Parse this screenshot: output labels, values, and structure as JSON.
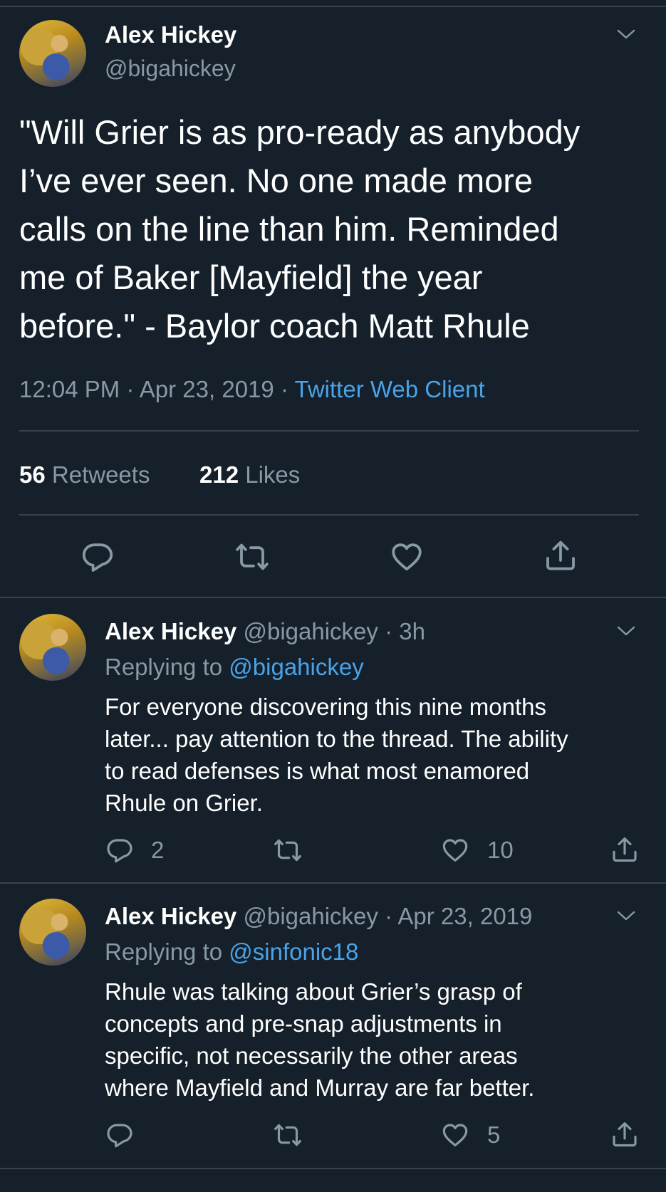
{
  "main_tweet": {
    "author_name": "Alex Hickey",
    "author_handle": "@bigahickey",
    "text_lines": [
      "\"Will Grier is as pro-ready as anybody",
      "I’ve ever seen. No one made more",
      "calls on the line than him. Reminded",
      "me of Baker [Mayfield] the year",
      "before.\" - Baylor coach Matt Rhule"
    ],
    "time": "12:04 PM",
    "date": "Apr 23, 2019",
    "separator": "·",
    "client": "Twitter Web Client",
    "retweets_count": "56",
    "retweets_label": "Retweets",
    "likes_count": "212",
    "likes_label": "Likes"
  },
  "replies": [
    {
      "author_name": "Alex Hickey",
      "author_handle": "@bigahickey",
      "time_ago": "· 3h",
      "replying_prefix": "Replying to",
      "replying_to": "@bigahickey",
      "text_lines": [
        "For everyone discovering this nine months",
        "later... pay attention to the thread. The ability",
        "to read defenses is what most enamored",
        "Rhule on Grier."
      ],
      "reply_count": "2",
      "retweet_count": "",
      "like_count": "10"
    },
    {
      "author_name": "Alex Hickey",
      "author_handle": "@bigahickey",
      "time_ago": "· Apr 23, 2019",
      "replying_prefix": "Replying to",
      "replying_to": "@sinfonic18",
      "text_lines": [
        "Rhule was talking about Grier’s grasp of",
        "concepts and pre-snap adjustments in",
        "specific, not necessarily the other areas",
        "where Mayfield and Murray are far better."
      ],
      "reply_count": "",
      "retweet_count": "",
      "like_count": "5"
    }
  ],
  "icons": {
    "reply": "reply-icon",
    "retweet": "retweet-icon",
    "like": "heart-icon",
    "share": "share-icon",
    "caret": "chevron-down-icon"
  },
  "colors": {
    "background": "#15202b",
    "muted": "#8899a6",
    "link": "#4aa3e8",
    "divider": "#38444d"
  }
}
